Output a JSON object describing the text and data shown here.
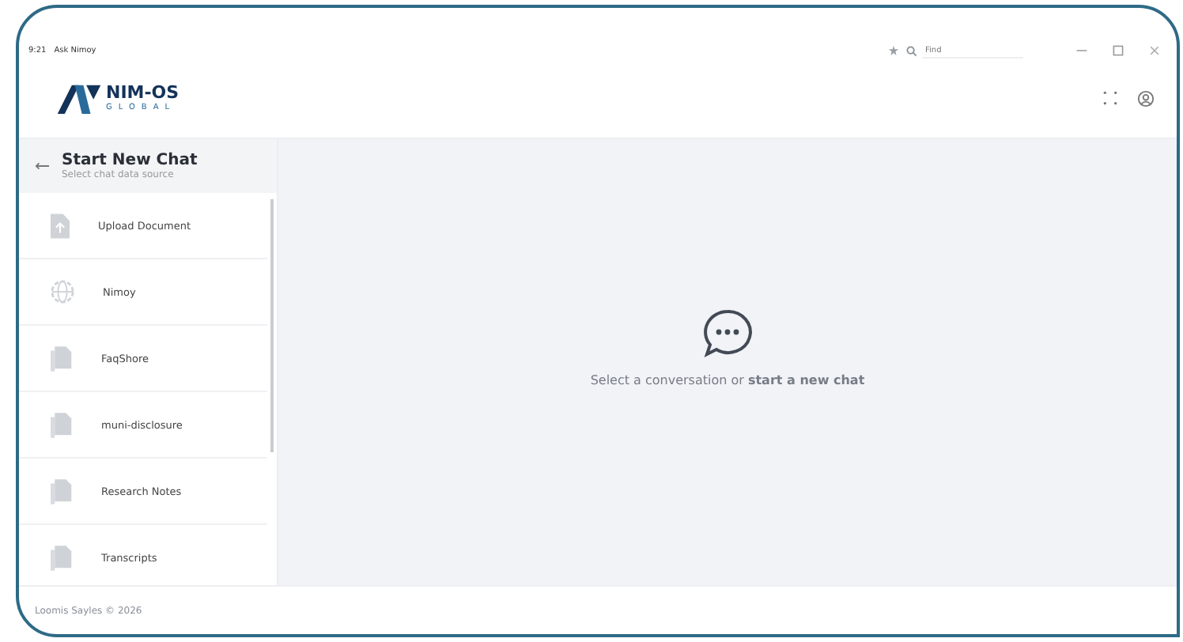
{
  "titlebar": {
    "time": "9:21",
    "app_title": "Ask Nimoy",
    "search": {
      "placeholder": "Find"
    }
  },
  "logo": {
    "name": "NIM-OS",
    "sub": "GLOBAL"
  },
  "sidebar": {
    "title": "Start New Chat",
    "subtitle": "Select chat data source",
    "items": [
      {
        "label": "Upload Document",
        "kind": "upload"
      },
      {
        "label": "Nimoy",
        "kind": "globe"
      },
      {
        "label": "FaqShore",
        "kind": "doc"
      },
      {
        "label": "muni-disclosure",
        "kind": "doc"
      },
      {
        "label": "Research Notes",
        "kind": "doc"
      },
      {
        "label": "Transcripts",
        "kind": "doc"
      }
    ]
  },
  "empty_state": {
    "message": "Select a conversation or **start a new chat**"
  },
  "footer": "Loomis Sayles © 2026"
}
